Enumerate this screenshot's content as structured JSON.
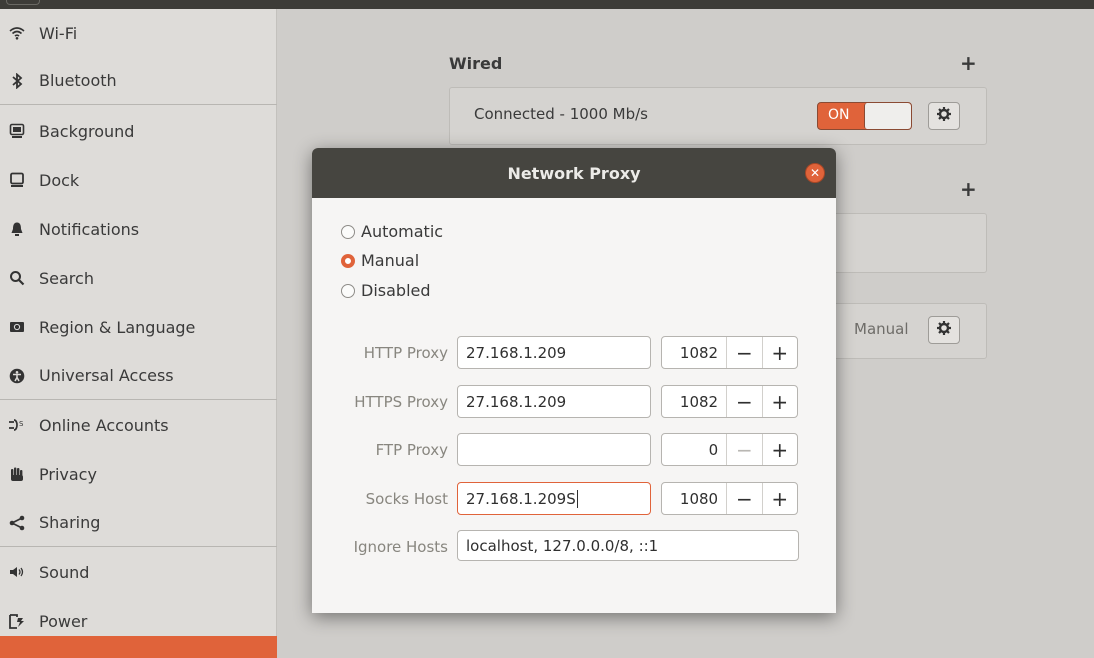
{
  "sidebar": {
    "items": [
      {
        "label": "Wi-Fi",
        "icon": "wifi-icon"
      },
      {
        "label": "Bluetooth",
        "icon": "bluetooth-icon"
      },
      {
        "label": "Background",
        "icon": "background-icon"
      },
      {
        "label": "Dock",
        "icon": "dock-icon"
      },
      {
        "label": "Notifications",
        "icon": "bell-icon"
      },
      {
        "label": "Search",
        "icon": "search-icon"
      },
      {
        "label": "Region & Language",
        "icon": "flag-icon"
      },
      {
        "label": "Universal Access",
        "icon": "accessibility-icon"
      },
      {
        "label": "Online Accounts",
        "icon": "online-accounts-icon"
      },
      {
        "label": "Privacy",
        "icon": "hand-icon"
      },
      {
        "label": "Sharing",
        "icon": "share-icon"
      },
      {
        "label": "Sound",
        "icon": "speaker-icon"
      },
      {
        "label": "Power",
        "icon": "power-icon"
      }
    ]
  },
  "main": {
    "wired_title": "Wired",
    "wired_status": "Connected - 1000 Mb/s",
    "toggle_label": "ON",
    "proxy_mode": "Manual"
  },
  "dialog": {
    "title": "Network Proxy",
    "modes": {
      "automatic": "Automatic",
      "manual": "Manual",
      "disabled": "Disabled"
    },
    "selected_mode": "Manual",
    "rows": {
      "http": {
        "label": "HTTP Proxy",
        "host": "27.168.1.209",
        "port": "1082"
      },
      "https": {
        "label": "HTTPS Proxy",
        "host": "27.168.1.209",
        "port": "1082"
      },
      "ftp": {
        "label": "FTP Proxy",
        "host": "",
        "port": "0"
      },
      "socks": {
        "label": "Socks Host",
        "host": "27.168.1.209S",
        "port": "1080"
      }
    },
    "ignore": {
      "label": "Ignore Hosts",
      "value": "localhost, 127.0.0.0/8, ::1"
    }
  },
  "colors": {
    "accent": "#e0633a",
    "header": "#464540"
  }
}
